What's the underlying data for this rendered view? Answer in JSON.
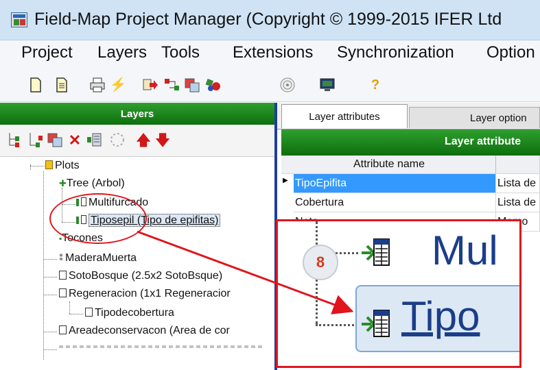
{
  "window": {
    "title": "Field-Map Project Manager (Copyright © 1999-2015 IFER Ltd"
  },
  "menu": [
    "Project",
    "Layers",
    "Tools",
    "Extensions",
    "Synchronization",
    "Option"
  ],
  "toolbar_icons": [
    "new-project-icon",
    "open-project-icon",
    "print-icon",
    "run-icon",
    "export-icon",
    "data-transfer-icon",
    "database-icon",
    "shapes-icon",
    "target-icon",
    "monitor-icon",
    "help-icon"
  ],
  "layers_panel": {
    "header": "Layers",
    "tool_icons": [
      "add-child-layer-icon",
      "add-layer-icon",
      "copy-layer-icon",
      "delete-icon",
      "layer-properties-icon",
      "refresh-icon",
      "move-up-icon",
      "move-down-icon"
    ],
    "tree": [
      {
        "label": "Plots"
      },
      {
        "label": "Tree (Arbol)"
      },
      {
        "label": "Multifurcado"
      },
      {
        "label": "Tiposepil (Tipo de epifitas)"
      },
      {
        "label": "Tocones"
      },
      {
        "label": "MaderaMuerta"
      },
      {
        "label": "SotoBosque (2.5x2 SotoBsque)"
      },
      {
        "label": "Regeneracion (1x1 Regeneracior"
      },
      {
        "label": "Tipodecobertura"
      },
      {
        "label": "Areadeconservacon (Area de cor"
      }
    ]
  },
  "right_panel": {
    "tabs": [
      "Layer attributes",
      "Layer option"
    ],
    "header": "Layer attribute",
    "column_header": "Attribute name",
    "rows": [
      {
        "name": "TipoEpifita",
        "type": "Lista de"
      },
      {
        "name": "Cobertura",
        "type": "Lista de"
      },
      {
        "name": "Nota",
        "type": "Memo"
      }
    ]
  },
  "callout": {
    "step": "8",
    "item1": "Mul",
    "item2": "Tipo"
  },
  "colors": {
    "header_green": "#0d6f0d",
    "selection_blue": "#3399ff",
    "annotation_red": "#e0141c"
  }
}
